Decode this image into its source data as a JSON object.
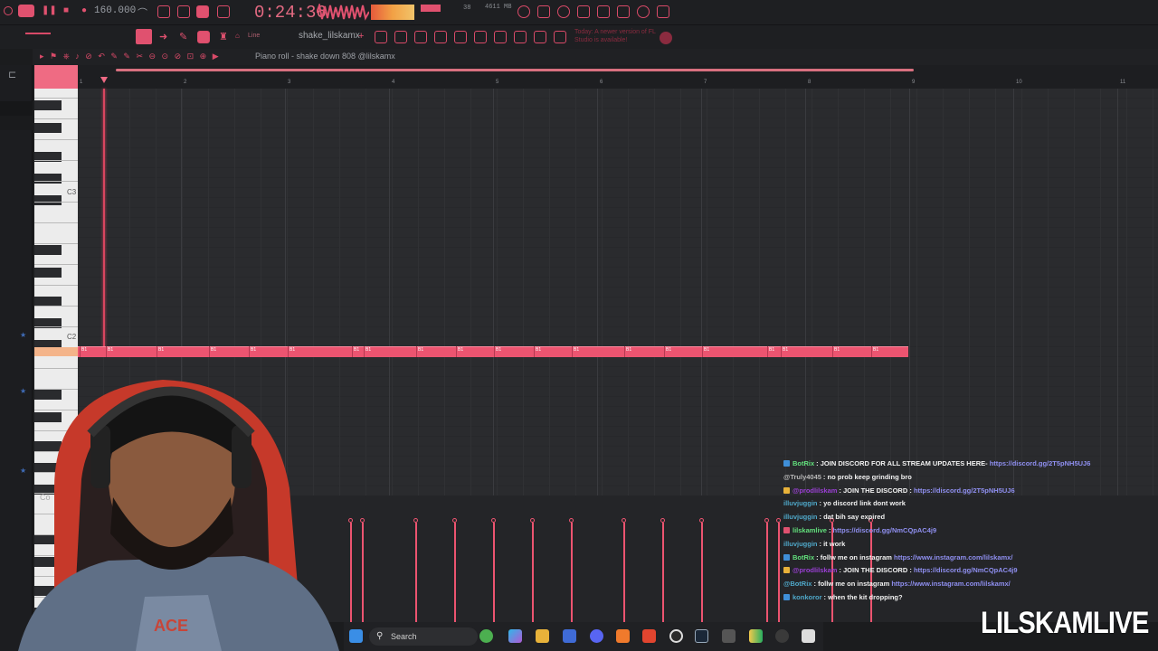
{
  "app": {
    "tempo": "160.000",
    "time_display": "0:24:36",
    "memory": "4611 MB",
    "cpu_value": "38",
    "notice": "Today: A newer version of FL Studio is available!",
    "pattern_name": "shake_lilskamx",
    "snap_mode": "Line"
  },
  "piano_roll": {
    "title": "Piano roll - shake down 808 @lilskamx",
    "ruler_numbers": [
      "1",
      "2",
      "3",
      "4",
      "5",
      "6",
      "7",
      "8",
      "9",
      "10",
      "11"
    ],
    "octave_labels": [
      "C3",
      "C2"
    ],
    "note_label": "B1",
    "note_count": 23,
    "corner_label": "Co"
  },
  "taskbar": {
    "search_placeholder": "Search",
    "icons": [
      "start-icon",
      "search-icon",
      "plant-icon",
      "copilot-icon",
      "folder-icon",
      "store-icon",
      "discord-icon",
      "fl-studio-icon",
      "brave-icon",
      "obs-icon",
      "steam-icon",
      "app-icon",
      "color-icon",
      "4k-icon",
      "media-icon"
    ]
  },
  "chat": [
    {
      "user": "BotRix",
      "user_color": "#62e07c",
      "badge": "#3f8fd8",
      "text": ": JOIN DISCORD FOR ALL STREAM UPDATES HERE- ",
      "url": "https://discord.gg/2T5pNH5UJ6"
    },
    {
      "user": "@Truly4045",
      "user_color": "#b9b9b9",
      "badge": "",
      "text": ": no prob keep grinding bro",
      "url": ""
    },
    {
      "user": "@prodlilskam",
      "user_color": "#9a3fd4",
      "badge": "#e8b23a",
      "text": ": JOIN THE DISCORD : ",
      "url": "https://discord.gg/2T5pNH5UJ6"
    },
    {
      "user": "illuvjuggin",
      "user_color": "#4fa8c9",
      "badge": "",
      "text": ": yo discord link dont work",
      "url": ""
    },
    {
      "user": "illuvjuggin",
      "user_color": "#4fa8c9",
      "badge": "",
      "text": ": dat bih say expired",
      "url": ""
    },
    {
      "user": "lilskamlive",
      "user_color": "#62e07c",
      "badge": "#e0516f",
      "text": ": ",
      "url": "https://discord.gg/NmCQpAC4j9"
    },
    {
      "user": "illuvjuggin",
      "user_color": "#4fa8c9",
      "badge": "",
      "text": ": it work",
      "url": ""
    },
    {
      "user": "BotRix",
      "user_color": "#62e07c",
      "badge": "#3f8fd8",
      "text": ": follw me on instagram ",
      "url": "https://www.instagram.com/lilskamx/"
    },
    {
      "user": "@prodlilskam",
      "user_color": "#9a3fd4",
      "badge": "#e8b23a",
      "text": ": JOIN THE DISCORD : ",
      "url": "https://discord.gg/NmCQpAC4j9"
    },
    {
      "user": "@BotRix",
      "user_color": "#4fa8c9",
      "badge": "",
      "text": ": follw me on instagram ",
      "url": "https://www.instagram.com/lilskamx/"
    },
    {
      "user": "konkoror",
      "user_color": "#4fa8c9",
      "badge": "#3f8fd8",
      "text": ": when the kit dropping?",
      "url": ""
    }
  ],
  "watermark": "LILSKAMLIVE"
}
